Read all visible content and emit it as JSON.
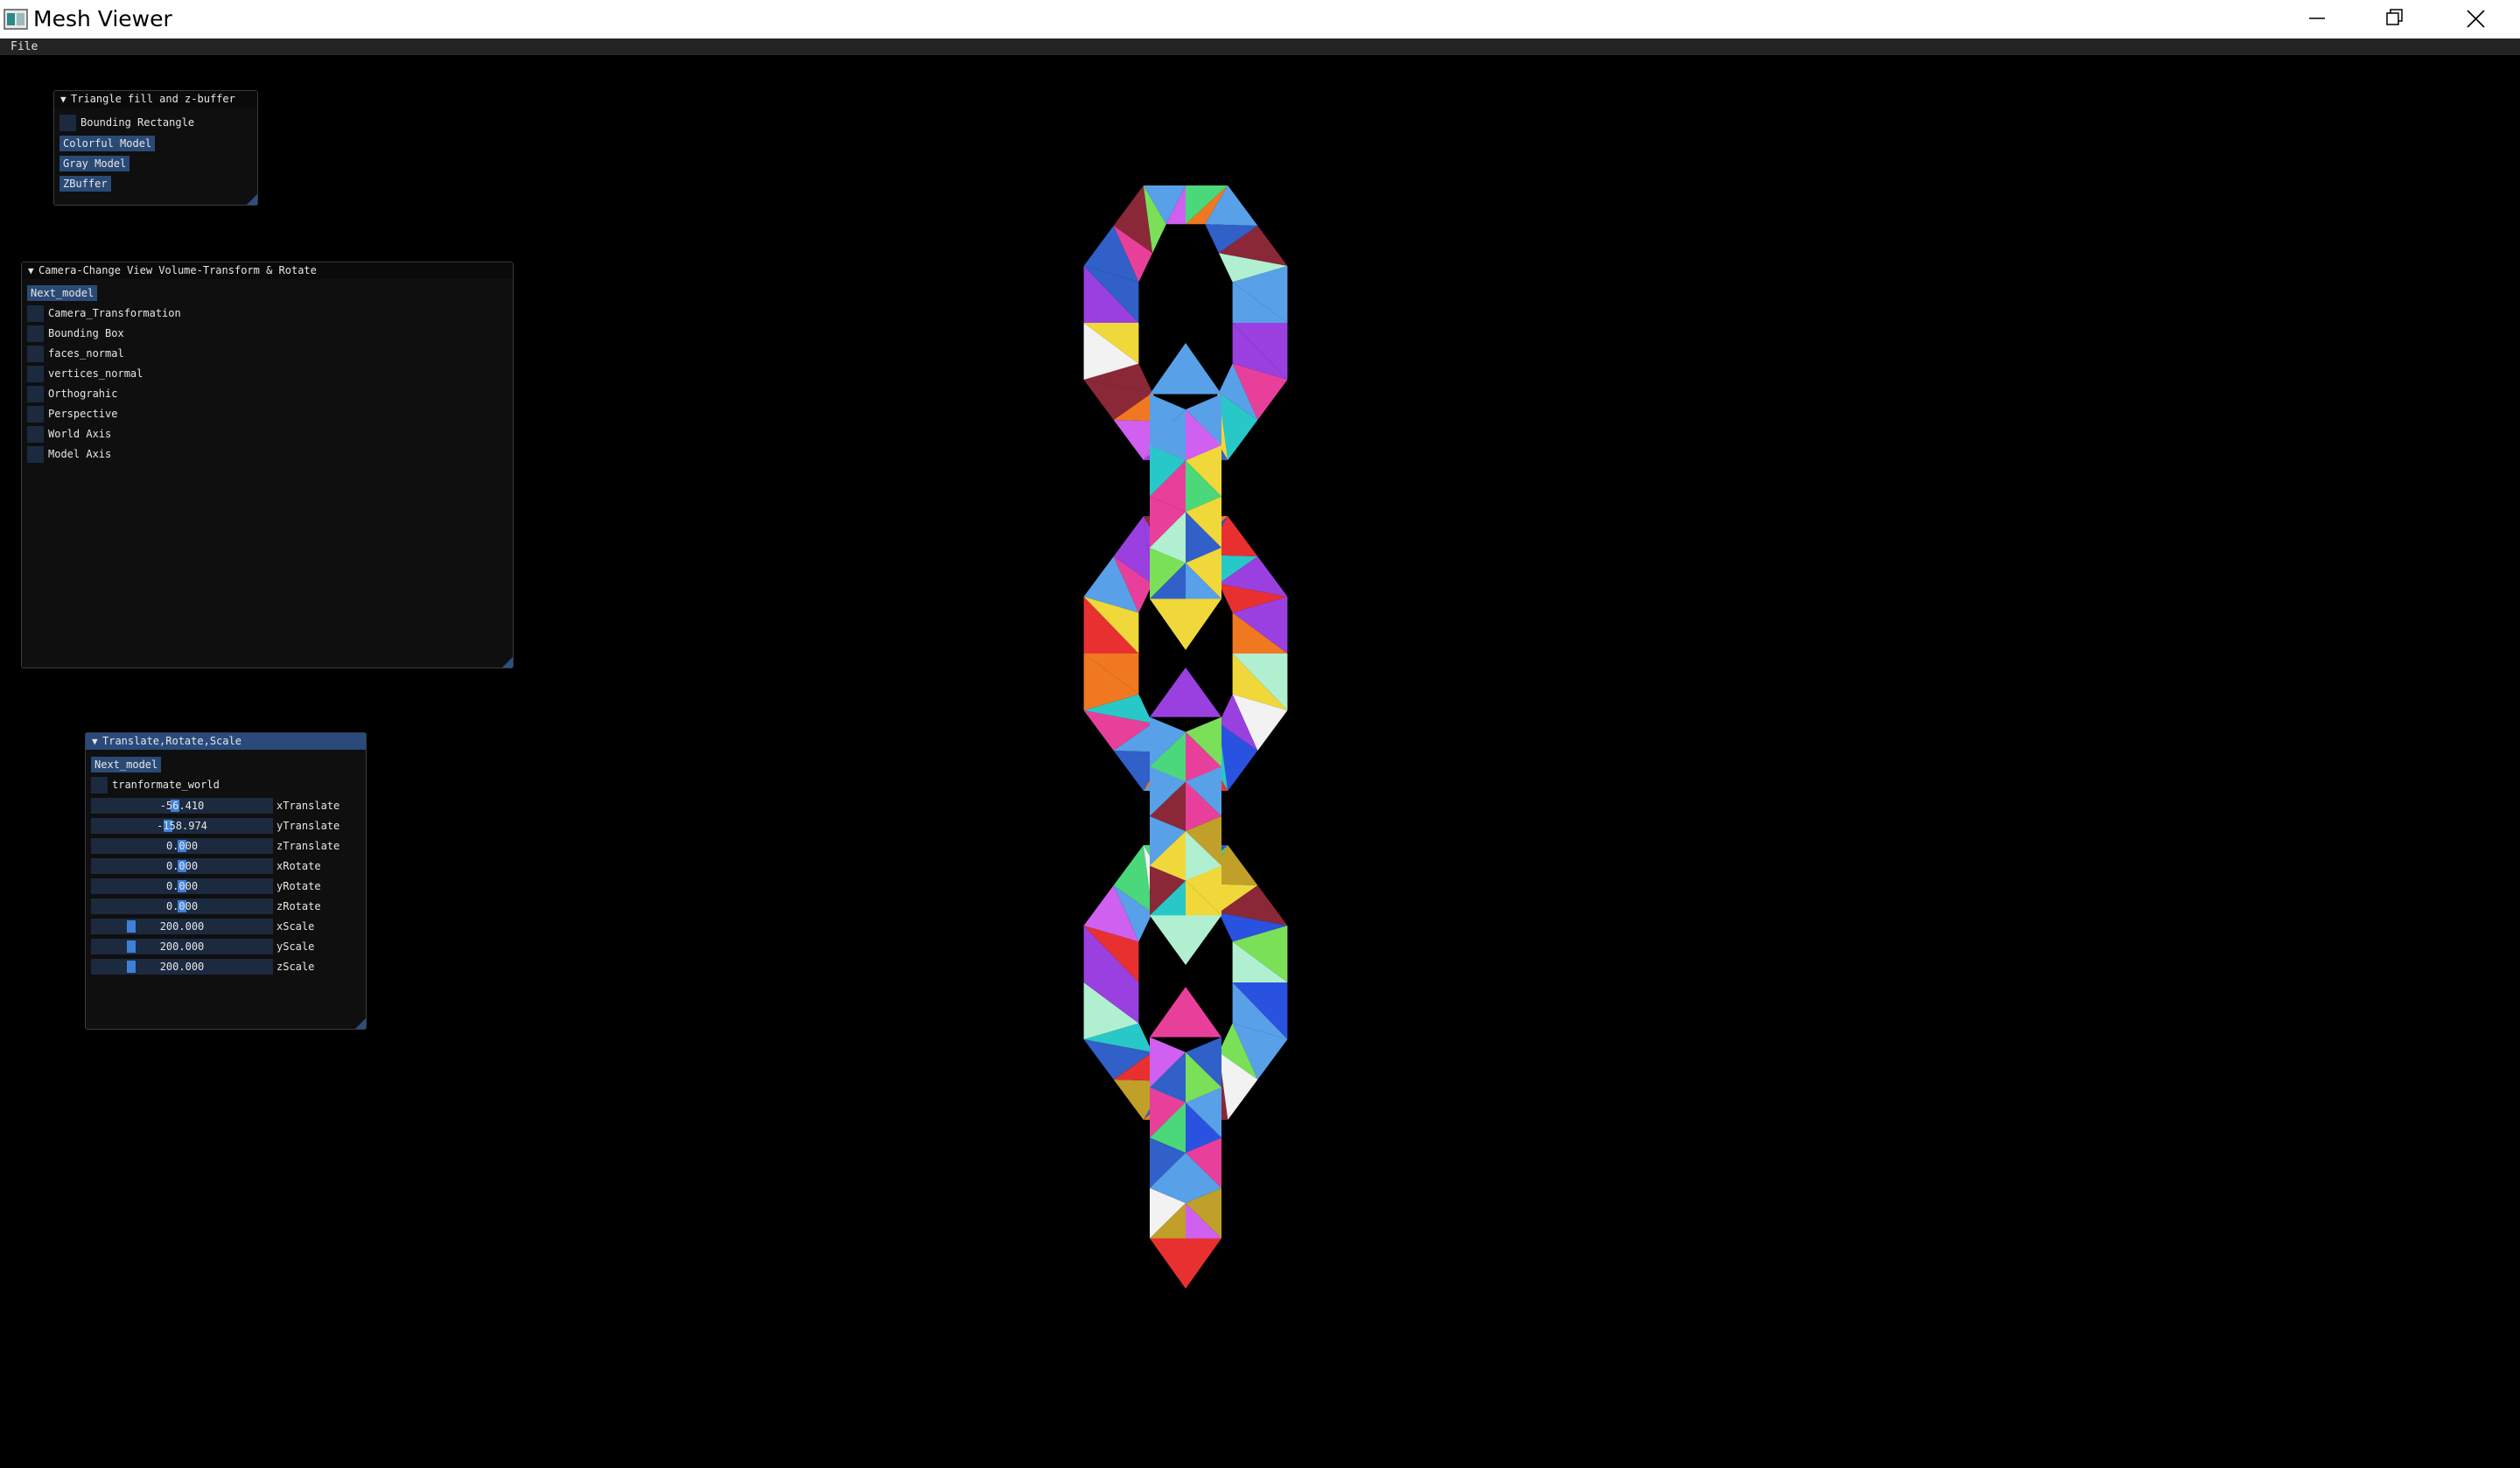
{
  "window": {
    "title": "Mesh Viewer",
    "icon": "mesh-viewer-app-icon"
  },
  "menu": {
    "file": "File"
  },
  "panel_fill": {
    "title": "Triangle fill and z-buffer",
    "bounding_rectangle": "Bounding Rectangle",
    "colorful_model": "Colorful Model",
    "gray_model": "Gray Model",
    "zbuffer": "ZBuffer"
  },
  "panel_camera": {
    "title": "Camera-Change View Volume-Transform & Rotate",
    "next_model": "Next_model",
    "items": [
      "Camera_Transformation",
      "Bounding Box",
      "faces_normal",
      "vertices_normal",
      "Orthograhic",
      "Perspective",
      "World Axis",
      "Model Axis"
    ]
  },
  "panel_trs": {
    "title": "Translate,Rotate,Scale",
    "next_model": "Next_model",
    "transform_world": "tranformate_world",
    "sliders": [
      {
        "value": "-56.410",
        "label": "xTranslate",
        "fraction": 0.46
      },
      {
        "value": "-158.974",
        "label": "yTranslate",
        "fraction": 0.42
      },
      {
        "value": "0.000",
        "label": "zTranslate",
        "fraction": 0.5
      },
      {
        "value": "0.000",
        "label": "xRotate",
        "fraction": 0.5
      },
      {
        "value": "0.000",
        "label": "yRotate",
        "fraction": 0.5
      },
      {
        "value": "0.000",
        "label": "zRotate",
        "fraction": 0.5
      },
      {
        "value": "200.000",
        "label": "xScale",
        "fraction": 0.2
      },
      {
        "value": "200.000",
        "label": "yScale",
        "fraction": 0.2
      },
      {
        "value": "200.000",
        "label": "zScale",
        "fraction": 0.2
      }
    ]
  },
  "colors": {
    "background": "#000000",
    "panel_bg": "#0f0f0f",
    "button": "#2a4a76",
    "active_title": "#294a7a",
    "slider_grab": "#3d80d8"
  },
  "viewport": {
    "content": "colorful-chain-mesh",
    "palette": [
      "#e8409a",
      "#4ad87a",
      "#2a52e0",
      "#f0d83a",
      "#28c8c8",
      "#9a40e0",
      "#e83030",
      "#7ae058",
      "#f07820",
      "#b0f0d0",
      "#8a2838",
      "#3060c8",
      "#d060f0",
      "#f2f2f2",
      "#58a0e8",
      "#c0a028"
    ]
  }
}
